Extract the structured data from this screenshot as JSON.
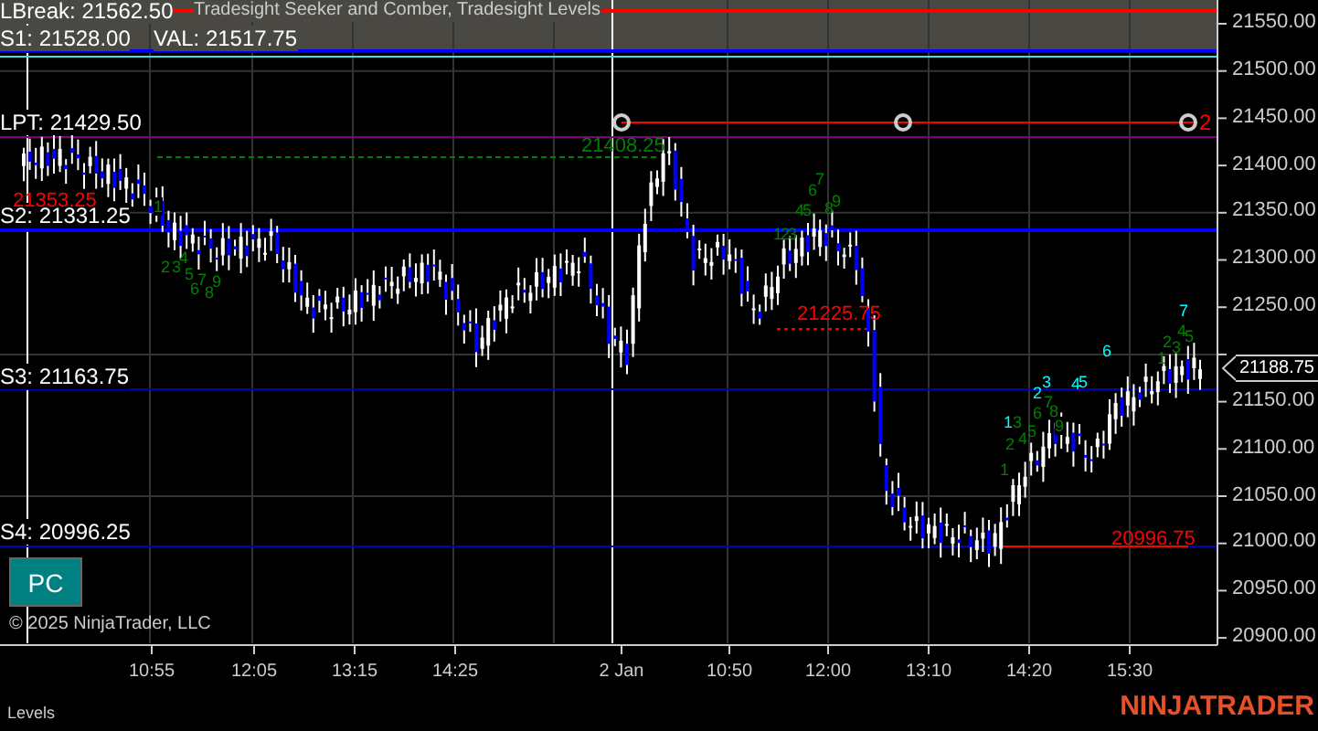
{
  "chart": {
    "title": "Tradesight Seeker and Comber, Tradesight Levels",
    "level_labels": [
      {
        "text": "LBreak: 21562.50"
      },
      {
        "text": "S1: 21528.00"
      },
      {
        "text": "VAL: 21517.75"
      },
      {
        "text": "LPT: 21429.50"
      },
      {
        "text": "S2: 21331.25"
      },
      {
        "text": "S3: 21163.75"
      },
      {
        "text": "S4: 20996.25"
      }
    ],
    "price_callouts": [
      {
        "text": "21408.25",
        "color": "#008000"
      },
      {
        "text": "21353.25",
        "color": "#ff0000"
      },
      {
        "text": "21225.75",
        "color": "#ff0000"
      },
      {
        "text": "20996.75",
        "color": "#ff0000"
      }
    ],
    "signal_count": "2",
    "count_marks": [
      {
        "text": "1",
        "color": "#008000"
      },
      {
        "text": "2",
        "color": "#008000"
      },
      {
        "text": "3",
        "color": "#008000"
      },
      {
        "text": "4",
        "color": "#008000"
      },
      {
        "text": "5",
        "color": "#008000"
      },
      {
        "text": "6",
        "color": "#008000"
      },
      {
        "text": "7",
        "color": "#008000"
      },
      {
        "text": "8",
        "color": "#008000"
      },
      {
        "text": "9",
        "color": "#008000"
      },
      {
        "text": "1",
        "color": "#008000"
      },
      {
        "text": "2",
        "color": "#008000"
      },
      {
        "text": "3",
        "color": "#008000"
      },
      {
        "text": "4",
        "color": "#008000"
      },
      {
        "text": "5",
        "color": "#008000"
      },
      {
        "text": "6",
        "color": "#008000"
      },
      {
        "text": "7",
        "color": "#008000"
      },
      {
        "text": "8",
        "color": "#008000"
      },
      {
        "text": "9",
        "color": "#008000"
      },
      {
        "text": "1",
        "color": "#00ffff"
      },
      {
        "text": "3",
        "color": "#008000"
      },
      {
        "text": "2",
        "color": "#008000"
      },
      {
        "text": "4",
        "color": "#008000"
      },
      {
        "text": "5",
        "color": "#008000"
      },
      {
        "text": "1",
        "color": "#008000"
      },
      {
        "text": "2",
        "color": "#00ffff"
      },
      {
        "text": "3",
        "color": "#00ffff"
      },
      {
        "text": "6",
        "color": "#008000"
      },
      {
        "text": "7",
        "color": "#008000"
      },
      {
        "text": "8",
        "color": "#008000"
      },
      {
        "text": "9",
        "color": "#008000"
      },
      {
        "text": "4",
        "color": "#00ffff"
      },
      {
        "text": "5",
        "color": "#00ffff"
      },
      {
        "text": "6",
        "color": "#00ffff"
      },
      {
        "text": "1",
        "color": "#008000"
      },
      {
        "text": "2",
        "color": "#008000"
      },
      {
        "text": "3",
        "color": "#008000"
      },
      {
        "text": "4",
        "color": "#008000"
      },
      {
        "text": "5",
        "color": "#008000"
      },
      {
        "text": "7",
        "color": "#00ffff"
      }
    ],
    "current_price": "21188.75",
    "button": "PC",
    "copyright": "© 2025 NinjaTrader, LLC",
    "price_axis": [
      "21550.00",
      "21500.00",
      "21450.00",
      "21400.00",
      "21350.00",
      "21300.00",
      "21250.00",
      "21150.00",
      "21100.00",
      "21050.00",
      "21000.00",
      "20950.00",
      "20900.00"
    ],
    "time_axis": [
      "10:55",
      "12:05",
      "13:15",
      "14:25",
      "2 Jan",
      "10:50",
      "12:00",
      "13:10",
      "14:20",
      "15:30"
    ]
  },
  "footer": {
    "tab": "Levels",
    "logo": "NINJATRADER"
  }
}
